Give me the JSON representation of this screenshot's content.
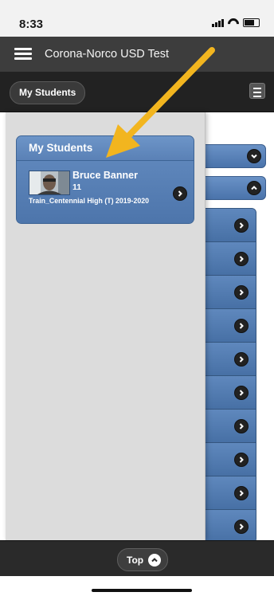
{
  "status_bar": {
    "time": "8:33"
  },
  "header": {
    "title": "Corona-Norco USD Test"
  },
  "toolbar": {
    "my_students_label": "My Students"
  },
  "panel": {
    "title": "My Students",
    "students": [
      {
        "name": "Bruce Banner",
        "grade": "11",
        "school": "Train_Centennial High (T)  2019-2020"
      }
    ]
  },
  "footer": {
    "top_label": "Top"
  },
  "colors": {
    "accent": "#5d84b8",
    "arrow": "#f2b51f",
    "dark_bar": "#222222"
  },
  "icons": {
    "menu": "hamburger-icon",
    "chevron": "chevron-right-icon",
    "collapse": "chevron-up-icon",
    "expand": "chevron-down-icon"
  }
}
